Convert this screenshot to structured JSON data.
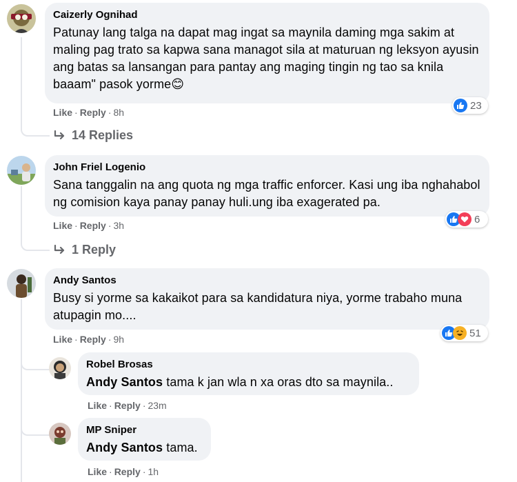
{
  "comments": [
    {
      "author": "Caizerly Ognihad",
      "text": "Patunay lang talga na dapat mag ingat sa maynila daming mga sakim at maling pag trato sa kapwa sana managot sila at maturuan ng leksyon ayusin ang batas sa lansangan para pantay ang maging tingin ng tao sa knila baaam\" pasok yorme",
      "emoji": "😊",
      "like": "Like",
      "reply": "Reply",
      "time": "8h",
      "reaction_count": "23",
      "replies_label": "14 Replies"
    },
    {
      "author": "John Friel Logenio",
      "text": "Sana tanggalin na ang quota ng mga traffic enforcer. Kasi ung iba nghahabol ng comision kaya panay panay huli.ung iba exagerated pa.",
      "like": "Like",
      "reply": "Reply",
      "time": "3h",
      "reaction_count": "6",
      "replies_label": "1 Reply"
    },
    {
      "author": "Andy Santos",
      "text": "Busy si yorme sa kakaikot para sa kandidatura niya, yorme trabaho muna atupagin mo....",
      "like": "Like",
      "reply": "Reply",
      "time": "9h",
      "reaction_count": "51"
    }
  ],
  "replies": [
    {
      "author": "Robel Brosas",
      "mention": "Andy Santos",
      "text": " tama k jan wla n xa oras dto sa maynila..",
      "like": "Like",
      "reply": "Reply",
      "time": "23m"
    },
    {
      "author": "MP Sniper",
      "mention": "Andy Santos",
      "text": " tama.",
      "like": "Like",
      "reply": "Reply",
      "time": "1h"
    }
  ],
  "colors": {
    "bubble": "#f0f2f5",
    "meta": "#65676b",
    "like_blue": "#1877f2",
    "love_red": "#f33e58",
    "haha_yellow": "#f7b125"
  },
  "icons": [
    "like-reaction-icon",
    "love-reaction-icon",
    "haha-reaction-icon",
    "reply-arrow-icon",
    "smiling-face-emoji"
  ]
}
